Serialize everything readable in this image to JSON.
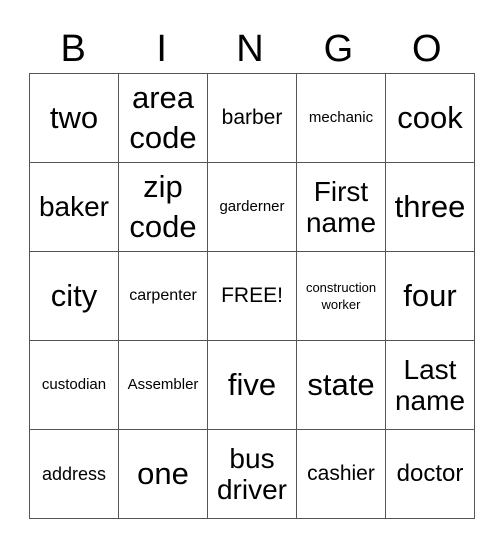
{
  "header": {
    "letters": [
      "B",
      "I",
      "N",
      "G",
      "O"
    ]
  },
  "rows": [
    [
      {
        "text": "two",
        "size": "s32"
      },
      {
        "text": "area code",
        "size": "s32"
      },
      {
        "text": "barber",
        "size": "s22"
      },
      {
        "text": "mechanic",
        "size": "s15"
      },
      {
        "text": "cook",
        "size": "s32"
      }
    ],
    [
      {
        "text": "baker",
        "size": "s28"
      },
      {
        "text": "zip code",
        "size": "s32"
      },
      {
        "text": "garderner",
        "size": "s15"
      },
      {
        "text": "First name",
        "size": "s28"
      },
      {
        "text": "three",
        "size": "s32"
      }
    ],
    [
      {
        "text": "city",
        "size": "s32"
      },
      {
        "text": "carpenter",
        "size": "s16"
      },
      {
        "text": "FREE!",
        "size": "s22"
      },
      {
        "text": "construction worker",
        "size": "s13"
      },
      {
        "text": "four",
        "size": "s32"
      }
    ],
    [
      {
        "text": "custodian",
        "size": "s15"
      },
      {
        "text": "Assembler",
        "size": "s15"
      },
      {
        "text": "five",
        "size": "s32"
      },
      {
        "text": "state",
        "size": "s32"
      },
      {
        "text": "Last name",
        "size": "s28"
      }
    ],
    [
      {
        "text": "address",
        "size": "s18"
      },
      {
        "text": "one",
        "size": "s32"
      },
      {
        "text": "bus driver",
        "size": "s28"
      },
      {
        "text": "cashier",
        "size": "s22"
      },
      {
        "text": "doctor",
        "size": "s24"
      }
    ]
  ]
}
